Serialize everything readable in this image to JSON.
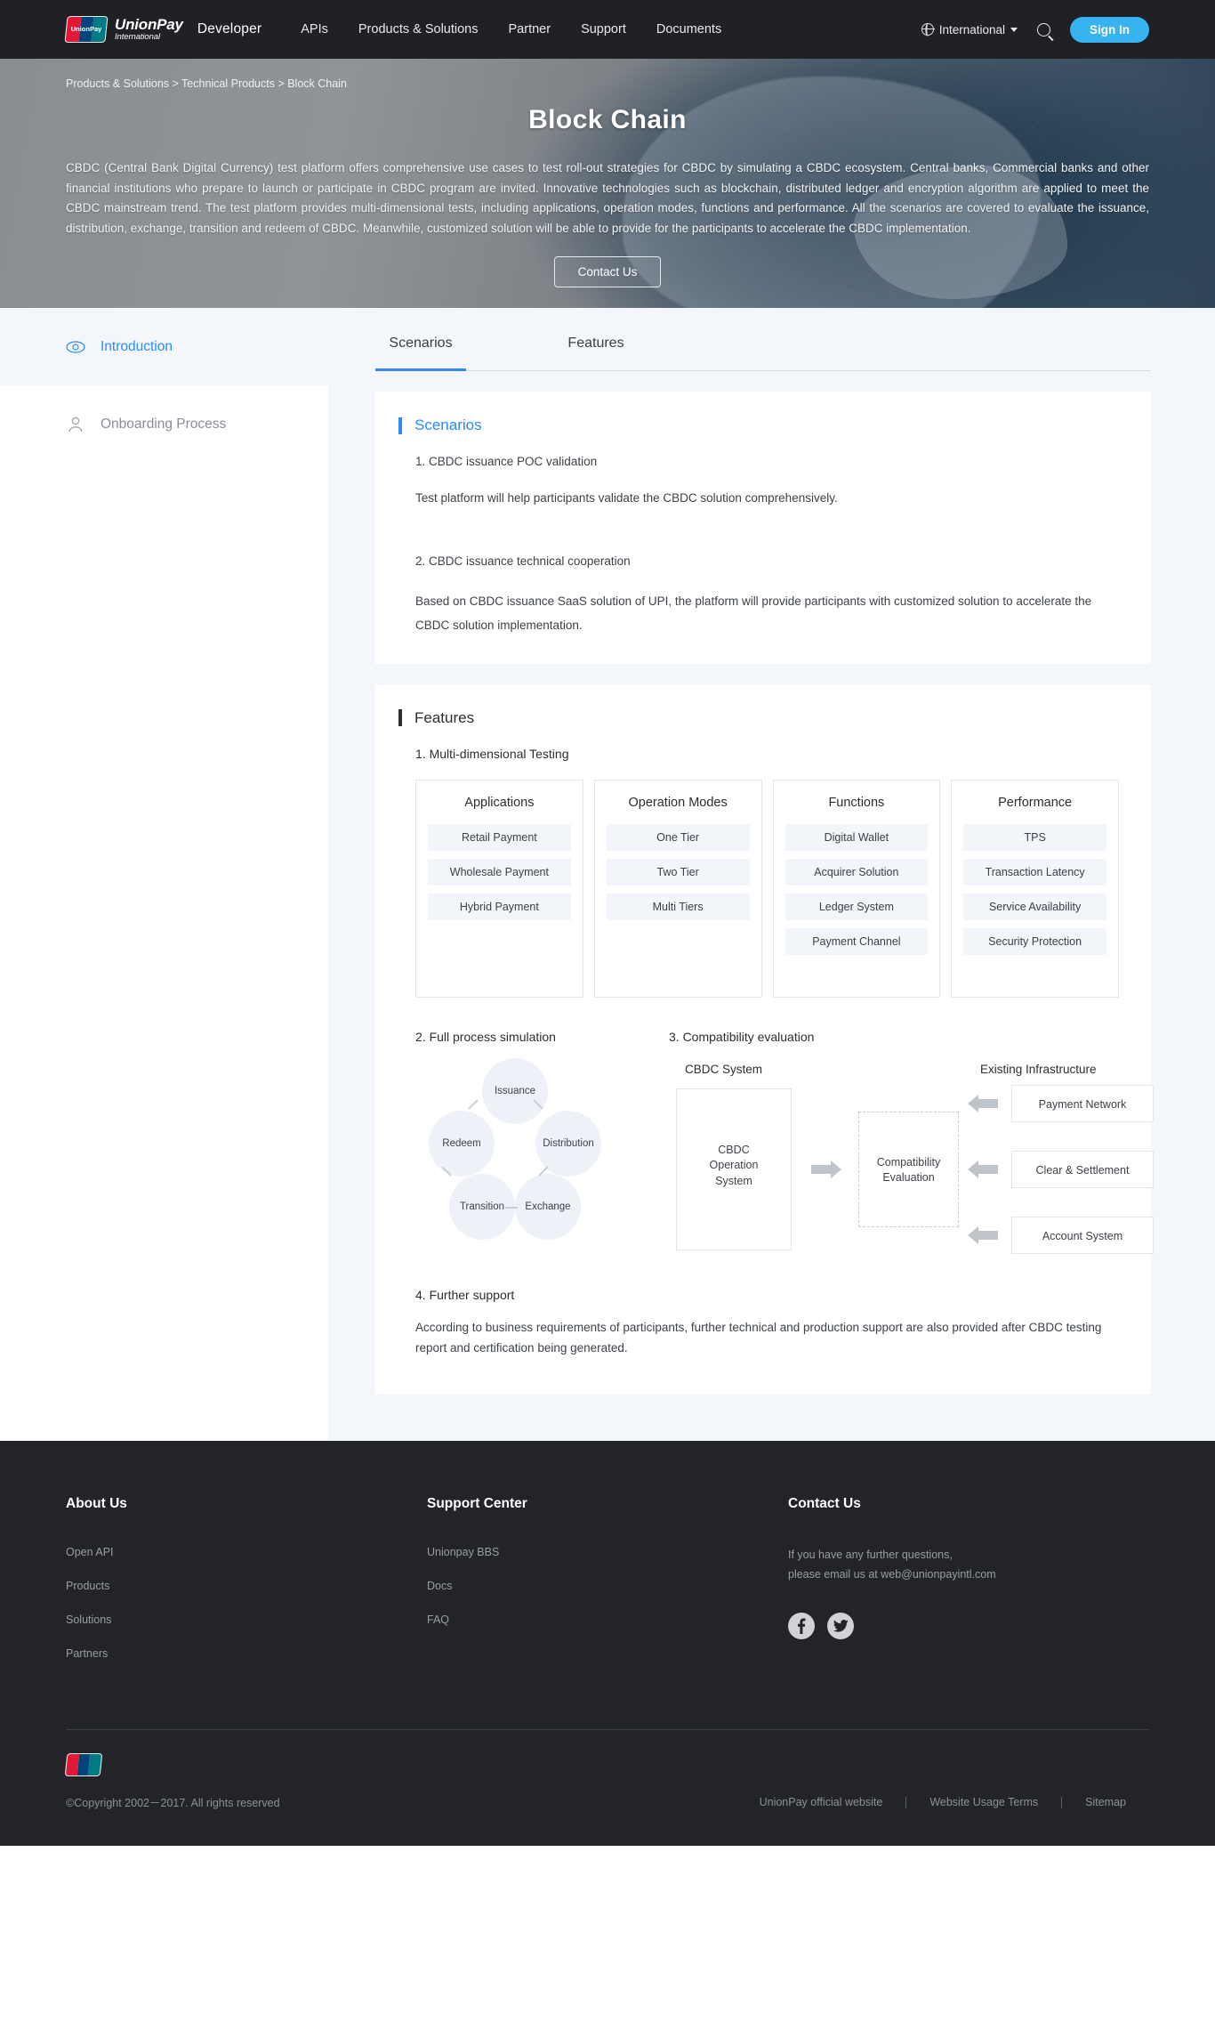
{
  "header": {
    "logo": {
      "line1": "UnionPay",
      "line2": "International",
      "mark_text": "UnionPay"
    },
    "developer_label": "Developer",
    "nav": [
      {
        "label": "APIs"
      },
      {
        "label": "Products & Solutions"
      },
      {
        "label": "Partner"
      },
      {
        "label": "Support"
      },
      {
        "label": "Documents"
      }
    ],
    "locale": "International",
    "sign_in": "Sign In",
    "icons": {
      "globe": "globe-icon",
      "caret": "chevron-down-icon",
      "search": "search-icon"
    }
  },
  "hero": {
    "breadcrumb": "Products & Solutions > Technical Products > Block Chain",
    "title": "Block Chain",
    "description": "CBDC (Central Bank Digital Currency) test platform offers comprehensive use cases to test roll-out strategies for CBDC by simulating a CBDC ecosystem. Central banks, Commercial banks and other financial institutions who prepare to launch or participate in CBDC program are invited. Innovative technologies such as blockchain, distributed ledger and encryption algorithm are applied to meet the CBDC mainstream trend.   The test platform provides multi-dimensional tests, including applications, operation modes, functions and performance. All the scenarios are covered to evaluate the  issuance, distribution, exchange, transition and redeem of CBDC. Meanwhile, customized solution will be able to provide for the participants to accelerate the CBDC implementation.",
    "contact_button": "Contact Us"
  },
  "sidebar": {
    "items": [
      {
        "label": "Introduction",
        "icon": "eye-icon",
        "active": true
      },
      {
        "label": "Onboarding Process",
        "icon": "user-icon",
        "active": false
      }
    ]
  },
  "tabs": [
    {
      "label": "Scenarios",
      "active": true
    },
    {
      "label": "Features",
      "active": false
    }
  ],
  "scenarios": {
    "heading": "Scenarios",
    "items": [
      {
        "title": "1. CBDC issuance POC validation",
        "body": "Test platform will help participants validate the CBDC solution comprehensively."
      },
      {
        "title": "2. CBDC issuance technical cooperation",
        "body": "Based on CBDC issuance SaaS solution of UPI, the platform will provide participants with customized solution to accelerate the CBDC solution implementation."
      }
    ]
  },
  "features": {
    "heading": "Features",
    "f1_title": "1. Multi-dimensional Testing",
    "columns": [
      {
        "head": "Applications",
        "chips": [
          "Retail Payment",
          "Wholesale Payment",
          "Hybrid Payment"
        ]
      },
      {
        "head": "Operation Modes",
        "chips": [
          "One Tier",
          "Two Tier",
          "Multi Tiers"
        ]
      },
      {
        "head": "Functions",
        "chips": [
          "Digital Wallet",
          "Acquirer Solution",
          "Ledger System",
          "Payment Channel"
        ]
      },
      {
        "head": "Performance",
        "chips": [
          "TPS",
          "Transaction Latency",
          "Service Availability",
          "Security Protection"
        ]
      }
    ],
    "f2_title": "2. Full process simulation",
    "cycle": [
      "Issuance",
      "Distribution",
      "Exchange",
      "Transition",
      "Redeem"
    ],
    "f3_title": "3. Compatibility evaluation",
    "compat": {
      "left_caption": "CBDC System",
      "right_caption": "Existing Infrastructure",
      "left_box": "CBDC\nOperation\nSystem",
      "left_box_l1": "CBDC",
      "left_box_l2": "Operation",
      "left_box_l3": "System",
      "center_box_l1": "Compatibility",
      "center_box_l2": "Evaluation",
      "right_boxes": [
        "Payment Network",
        "Clear & Settlement",
        "Account System"
      ]
    },
    "f4_title": "4. Further support",
    "f4_body": "According to business requirements of participants, further technical and production support are also provided after CBDC testing report and certification being generated."
  },
  "footer": {
    "columns": [
      {
        "head": "About Us",
        "links": [
          "Open API",
          "Products",
          "Solutions",
          "Partners"
        ]
      },
      {
        "head": "Support Center",
        "links": [
          "Unionpay BBS",
          "Docs",
          "FAQ"
        ]
      }
    ],
    "contact": {
      "head": "Contact Us",
      "line1": "If you have any further questions,",
      "line2": "please email us at web@unionpayintl.com",
      "socials": [
        {
          "name": "facebook-icon",
          "glyph": "f"
        },
        {
          "name": "twitter-icon",
          "glyph": "✈"
        }
      ]
    },
    "copyright": "©Copyright 2002－2017. All rights reserved",
    "bottom_links": [
      "UnionPay official website",
      "Website Usage Terms",
      "Sitemap"
    ]
  },
  "colors": {
    "accent": "#2a8cf5",
    "signin": "#37b4ef",
    "header_bg": "#1f2125",
    "footer_bg": "#222428",
    "content_bg": "#f3f6fa"
  }
}
